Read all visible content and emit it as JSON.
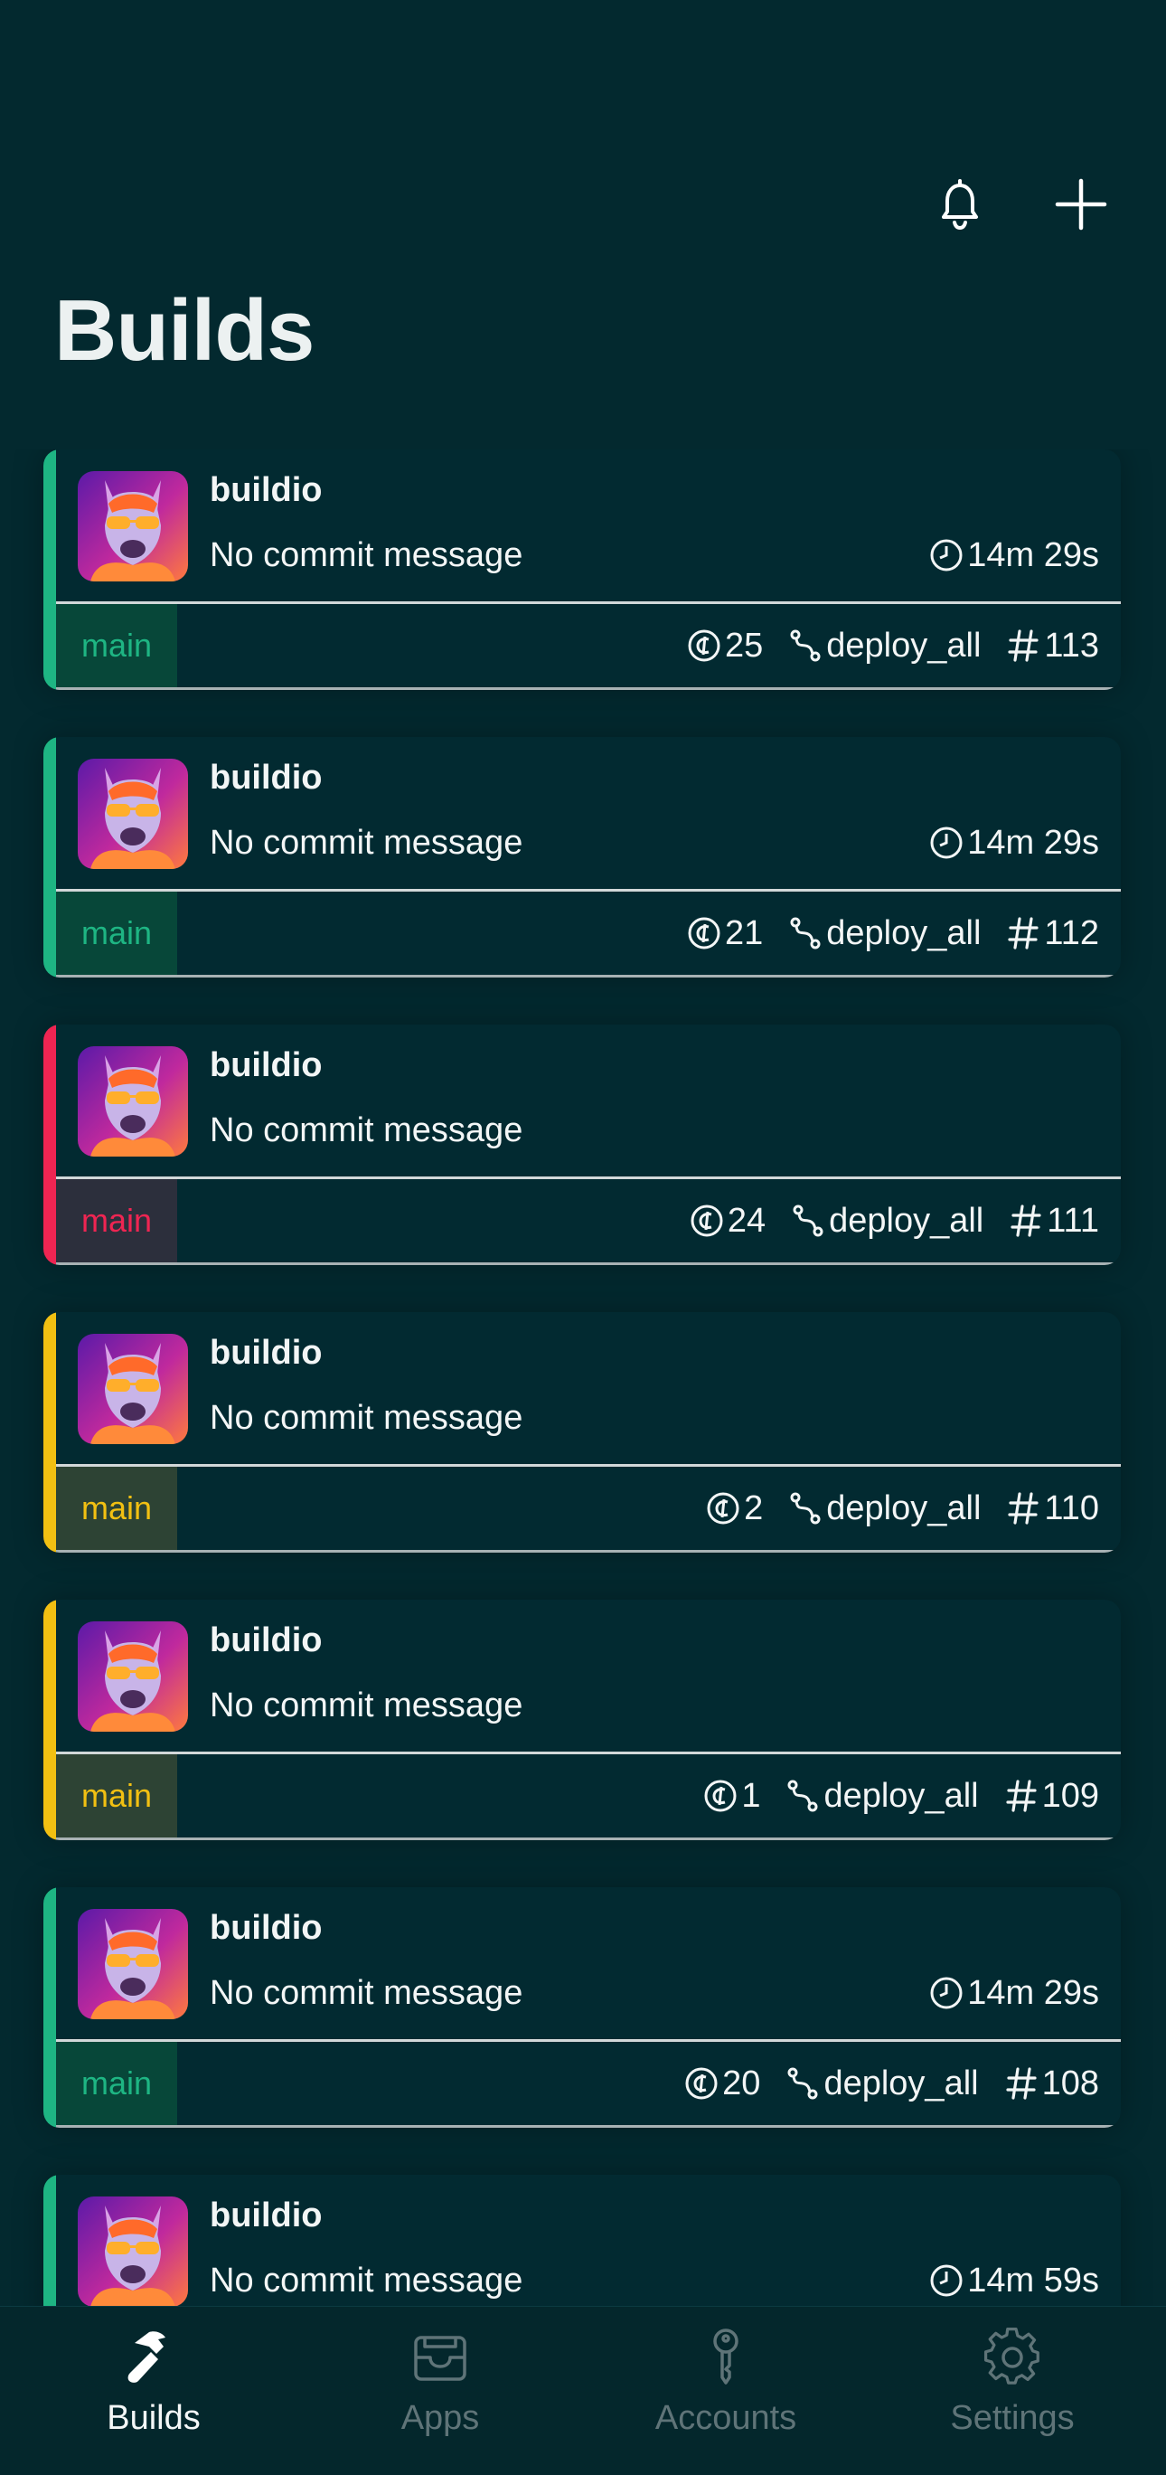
{
  "header": {
    "title": "Builds",
    "actions": [
      {
        "icon": "bell-icon",
        "label": ""
      },
      {
        "icon": "plus-icon",
        "label": ""
      }
    ]
  },
  "colors": {
    "success": "#1eb583",
    "failed": "#ef2552",
    "running": "#f2c012",
    "background": "#03292f"
  },
  "builds": [
    {
      "app": "buildio",
      "commit": "No commit message",
      "duration": "14m 29s",
      "branch": "main",
      "credits": "25",
      "workflow": "deploy_all",
      "number": "113",
      "status": "success"
    },
    {
      "app": "buildio",
      "commit": "No commit message",
      "duration": "14m 29s",
      "branch": "main",
      "credits": "21",
      "workflow": "deploy_all",
      "number": "112",
      "status": "success"
    },
    {
      "app": "buildio",
      "commit": "No commit message",
      "duration": "",
      "branch": "main",
      "credits": "24",
      "workflow": "deploy_all",
      "number": "111",
      "status": "failed"
    },
    {
      "app": "buildio",
      "commit": "No commit message",
      "duration": "",
      "branch": "main",
      "credits": "2",
      "workflow": "deploy_all",
      "number": "110",
      "status": "running"
    },
    {
      "app": "buildio",
      "commit": "No commit message",
      "duration": "",
      "branch": "main",
      "credits": "1",
      "workflow": "deploy_all",
      "number": "109",
      "status": "running"
    },
    {
      "app": "buildio",
      "commit": "No commit message",
      "duration": "14m 29s",
      "branch": "main",
      "credits": "20",
      "workflow": "deploy_all",
      "number": "108",
      "status": "success"
    },
    {
      "app": "buildio",
      "commit": "No commit message",
      "duration": "14m 59s",
      "branch": "main",
      "credits": "",
      "workflow": "",
      "number": "",
      "status": "success"
    }
  ],
  "tabs": [
    {
      "label": "Builds",
      "icon": "hammer-icon",
      "active": true
    },
    {
      "label": "Apps",
      "icon": "tray-icon",
      "active": false
    },
    {
      "label": "Accounts",
      "icon": "key-icon",
      "active": false
    },
    {
      "label": "Settings",
      "icon": "gear-icon",
      "active": false
    }
  ]
}
